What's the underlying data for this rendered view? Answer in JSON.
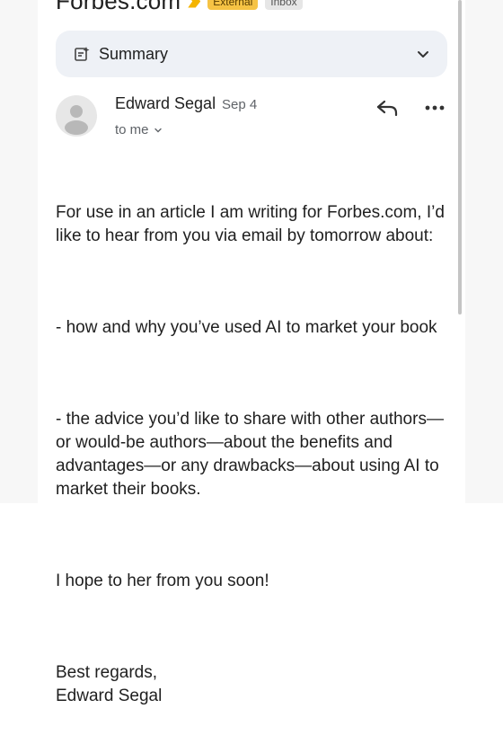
{
  "subject": {
    "text": "Forbes.com",
    "labels": [
      "External",
      "Inbox"
    ]
  },
  "summary": {
    "label": "Summary"
  },
  "sender": {
    "name": "Edward Segal",
    "date": "Sep 4",
    "to": "to me"
  },
  "body": {
    "paragraphs": [
      "For use in an article I am writing for Forbes.com, I’d like to hear from you via email by tomorrow about:",
      "- how and why you’ve used AI to market your book",
      "- the advice you’d like to share with other authors—or would-be authors—about the benefits and advantages—or any drawbacks—about using AI to market their books.",
      "I hope to her from you soon!",
      "Best regards,\nEdward Segal"
    ]
  },
  "icons": {
    "summary": "summary-sparkle-icon",
    "expand": "chevron-down-icon",
    "reply": "reply-icon",
    "more": "more-horizontal-icon",
    "avatar": "person-avatar-icon"
  },
  "colors": {
    "external_chip": "#f6c344",
    "summary_bg": "#eef1f6",
    "secondary_text": "#5f6368"
  }
}
